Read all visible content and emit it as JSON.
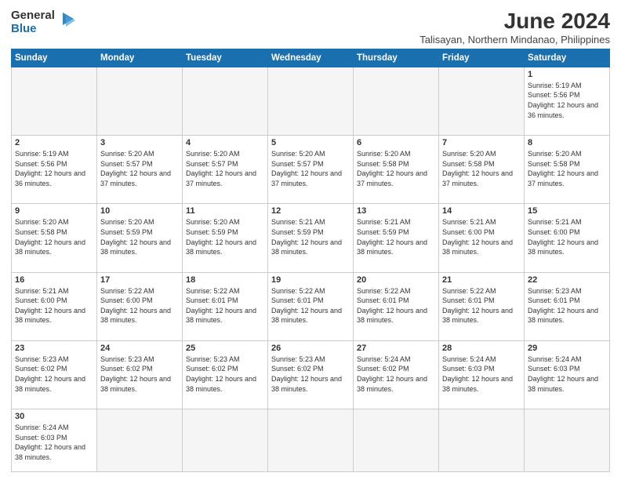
{
  "logo": {
    "general": "General",
    "blue": "Blue"
  },
  "title": "June 2024",
  "location": "Talisayan, Northern Mindanao, Philippines",
  "days_header": [
    "Sunday",
    "Monday",
    "Tuesday",
    "Wednesday",
    "Thursday",
    "Friday",
    "Saturday"
  ],
  "weeks": [
    [
      {
        "day": "",
        "empty": true
      },
      {
        "day": "",
        "empty": true
      },
      {
        "day": "",
        "empty": true
      },
      {
        "day": "",
        "empty": true
      },
      {
        "day": "",
        "empty": true
      },
      {
        "day": "",
        "empty": true
      },
      {
        "day": "1",
        "sunrise": "5:19 AM",
        "sunset": "5:56 PM",
        "daylight": "12 hours and 36 minutes."
      }
    ],
    [
      {
        "day": "2",
        "sunrise": "5:19 AM",
        "sunset": "5:56 PM",
        "daylight": "12 hours and 36 minutes."
      },
      {
        "day": "3",
        "sunrise": "5:20 AM",
        "sunset": "5:57 PM",
        "daylight": "12 hours and 37 minutes."
      },
      {
        "day": "4",
        "sunrise": "5:20 AM",
        "sunset": "5:57 PM",
        "daylight": "12 hours and 37 minutes."
      },
      {
        "day": "5",
        "sunrise": "5:20 AM",
        "sunset": "5:57 PM",
        "daylight": "12 hours and 37 minutes."
      },
      {
        "day": "6",
        "sunrise": "5:20 AM",
        "sunset": "5:58 PM",
        "daylight": "12 hours and 37 minutes."
      },
      {
        "day": "7",
        "sunrise": "5:20 AM",
        "sunset": "5:58 PM",
        "daylight": "12 hours and 37 minutes."
      },
      {
        "day": "8",
        "sunrise": "5:20 AM",
        "sunset": "5:58 PM",
        "daylight": "12 hours and 37 minutes."
      }
    ],
    [
      {
        "day": "9",
        "sunrise": "5:20 AM",
        "sunset": "5:58 PM",
        "daylight": "12 hours and 38 minutes."
      },
      {
        "day": "10",
        "sunrise": "5:20 AM",
        "sunset": "5:59 PM",
        "daylight": "12 hours and 38 minutes."
      },
      {
        "day": "11",
        "sunrise": "5:20 AM",
        "sunset": "5:59 PM",
        "daylight": "12 hours and 38 minutes."
      },
      {
        "day": "12",
        "sunrise": "5:21 AM",
        "sunset": "5:59 PM",
        "daylight": "12 hours and 38 minutes."
      },
      {
        "day": "13",
        "sunrise": "5:21 AM",
        "sunset": "5:59 PM",
        "daylight": "12 hours and 38 minutes."
      },
      {
        "day": "14",
        "sunrise": "5:21 AM",
        "sunset": "6:00 PM",
        "daylight": "12 hours and 38 minutes."
      },
      {
        "day": "15",
        "sunrise": "5:21 AM",
        "sunset": "6:00 PM",
        "daylight": "12 hours and 38 minutes."
      }
    ],
    [
      {
        "day": "16",
        "sunrise": "5:21 AM",
        "sunset": "6:00 PM",
        "daylight": "12 hours and 38 minutes."
      },
      {
        "day": "17",
        "sunrise": "5:22 AM",
        "sunset": "6:00 PM",
        "daylight": "12 hours and 38 minutes."
      },
      {
        "day": "18",
        "sunrise": "5:22 AM",
        "sunset": "6:01 PM",
        "daylight": "12 hours and 38 minutes."
      },
      {
        "day": "19",
        "sunrise": "5:22 AM",
        "sunset": "6:01 PM",
        "daylight": "12 hours and 38 minutes."
      },
      {
        "day": "20",
        "sunrise": "5:22 AM",
        "sunset": "6:01 PM",
        "daylight": "12 hours and 38 minutes."
      },
      {
        "day": "21",
        "sunrise": "5:22 AM",
        "sunset": "6:01 PM",
        "daylight": "12 hours and 38 minutes."
      },
      {
        "day": "22",
        "sunrise": "5:23 AM",
        "sunset": "6:01 PM",
        "daylight": "12 hours and 38 minutes."
      }
    ],
    [
      {
        "day": "23",
        "sunrise": "5:23 AM",
        "sunset": "6:02 PM",
        "daylight": "12 hours and 38 minutes."
      },
      {
        "day": "24",
        "sunrise": "5:23 AM",
        "sunset": "6:02 PM",
        "daylight": "12 hours and 38 minutes."
      },
      {
        "day": "25",
        "sunrise": "5:23 AM",
        "sunset": "6:02 PM",
        "daylight": "12 hours and 38 minutes."
      },
      {
        "day": "26",
        "sunrise": "5:23 AM",
        "sunset": "6:02 PM",
        "daylight": "12 hours and 38 minutes."
      },
      {
        "day": "27",
        "sunrise": "5:24 AM",
        "sunset": "6:02 PM",
        "daylight": "12 hours and 38 minutes."
      },
      {
        "day": "28",
        "sunrise": "5:24 AM",
        "sunset": "6:03 PM",
        "daylight": "12 hours and 38 minutes."
      },
      {
        "day": "29",
        "sunrise": "5:24 AM",
        "sunset": "6:03 PM",
        "daylight": "12 hours and 38 minutes."
      }
    ],
    [
      {
        "day": "30",
        "sunrise": "5:24 AM",
        "sunset": "6:03 PM",
        "daylight": "12 hours and 38 minutes."
      },
      {
        "day": "",
        "empty": true
      },
      {
        "day": "",
        "empty": true
      },
      {
        "day": "",
        "empty": true
      },
      {
        "day": "",
        "empty": true
      },
      {
        "day": "",
        "empty": true
      },
      {
        "day": "",
        "empty": true
      }
    ]
  ],
  "colors": {
    "header_bg": "#1a6faf",
    "blue_accent": "#1a6faf"
  }
}
